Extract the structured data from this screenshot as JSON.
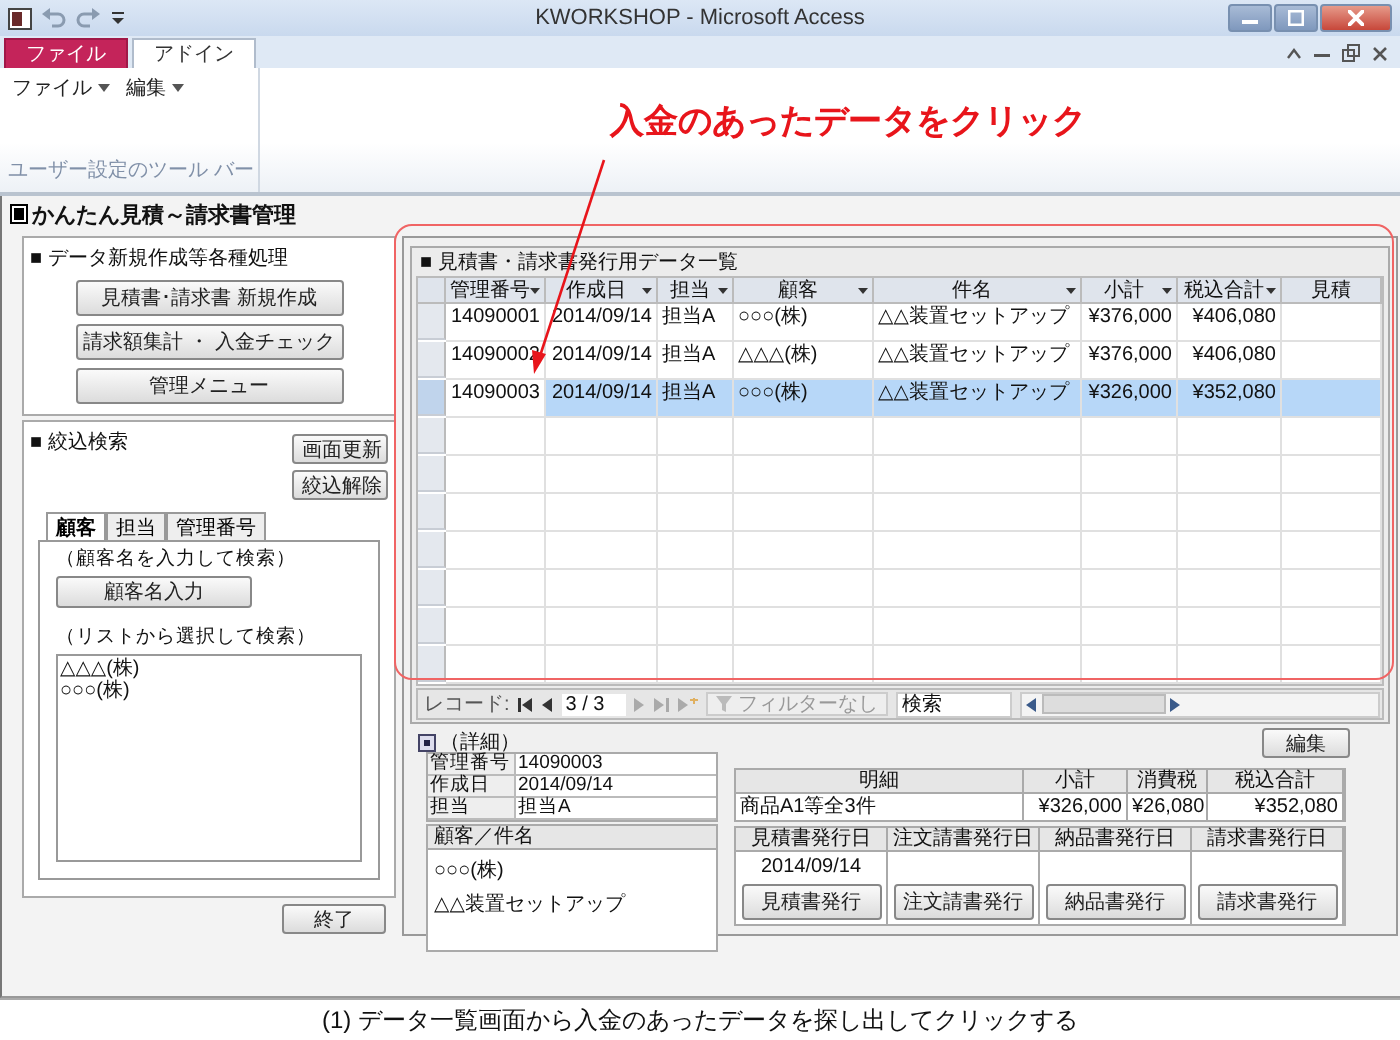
{
  "window": {
    "title": "KWORKSHOP - Microsoft Access"
  },
  "ribbon": {
    "tabs": [
      {
        "label": "ファイル",
        "kind": "file",
        "selected": false
      },
      {
        "label": "アドイン",
        "kind": "normal",
        "selected": true
      }
    ],
    "menus": [
      "ファイル",
      "編集"
    ],
    "group_label": "ユーザー設定のツール バー"
  },
  "annotation": {
    "text": "入金のあったデータをクリック"
  },
  "form": {
    "title": "かんたん見積～請求書管理",
    "actions": {
      "heading": "■ データ新規作成等各種処理",
      "buttons": [
        "見積書･請求書 新規作成",
        "請求額集計 ・ 入金チェック",
        "管理メニュー"
      ]
    },
    "filter": {
      "heading": "■ 絞込検索",
      "buttons": [
        "画面更新",
        "絞込解除"
      ],
      "tabs": [
        {
          "label": "顧客",
          "selected": true
        },
        {
          "label": "担当",
          "selected": false
        },
        {
          "label": "管理番号",
          "selected": false
        }
      ],
      "input_hint": "（顧客名を入力して検索）",
      "input_button": "顧客名入力",
      "list_hint": "（リストから選択して検索）",
      "list": [
        "△△△(株)",
        "○○○(株)"
      ]
    },
    "exit_button": "終了",
    "datasheet": {
      "title": "■ 見積書・請求書発行用データ一覧",
      "columns": [
        {
          "label": "管理番号",
          "kind": "number"
        },
        {
          "label": "作成日",
          "kind": "number"
        },
        {
          "label": "担当",
          "kind": "text"
        },
        {
          "label": "顧客",
          "kind": "text"
        },
        {
          "label": "件名",
          "kind": "text"
        },
        {
          "label": "小計",
          "kind": "number"
        },
        {
          "label": "税込合計",
          "kind": "number"
        },
        {
          "label": "見積",
          "kind": "text"
        }
      ],
      "rows": [
        {
          "cells": [
            "14090001",
            "2014/09/14",
            "担当A",
            "○○○(株)",
            "△△装置セットアップ",
            "¥376,000",
            "¥406,080"
          ],
          "selected": false
        },
        {
          "cells": [
            "14090002",
            "2014/09/14",
            "担当A",
            "△△△(株)",
            "△△装置セットアップ",
            "¥376,000",
            "¥406,080"
          ],
          "selected": false
        },
        {
          "cells": [
            "14090003",
            "2014/09/14",
            "担当A",
            "○○○(株)",
            "△△装置セットアップ",
            "¥326,000",
            "¥352,080"
          ],
          "selected": true
        }
      ],
      "nav": {
        "label": "レコード:",
        "position": "3 / 3",
        "filter": "フィルターなし",
        "search": "検索"
      }
    },
    "detail": {
      "toggle_label": "（詳細）",
      "edit_button": "編集",
      "fields": [
        {
          "label": "管理番号",
          "value": "14090003"
        },
        {
          "label": "作成日",
          "value": "2014/09/14"
        },
        {
          "label": "担当",
          "value": "担当A"
        }
      ],
      "customer_heading": "顧客／件名",
      "customer": "○○○(株)",
      "subject": "△△装置セットアップ",
      "summary": {
        "columns": [
          "明細",
          "小計",
          "消費税",
          "税込合計"
        ],
        "values": [
          "商品A1等全3件",
          "¥326,000",
          "¥26,080",
          "¥352,080"
        ]
      },
      "issues": [
        {
          "heading": "見積書発行日",
          "date": "2014/09/14",
          "button": "見積書発行"
        },
        {
          "heading": "注文請書発行日",
          "button": "注文請書発行"
        },
        {
          "heading": "納品書発行日",
          "button": "納品書発行"
        },
        {
          "heading": "請求書発行日",
          "button": "請求書発行"
        }
      ]
    }
  },
  "caption": "(1) データ一覧画面から入金のあったデータを探し出してクリックする"
}
